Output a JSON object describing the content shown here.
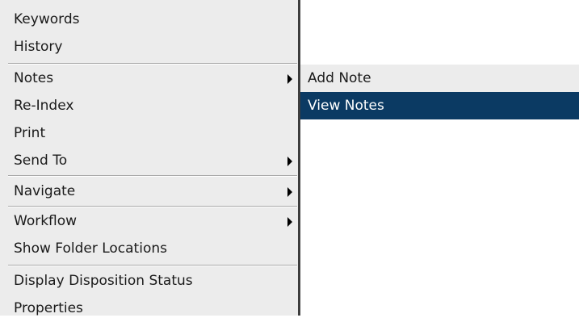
{
  "context_menu": {
    "items": [
      {
        "label": "Keywords"
      },
      {
        "label": "History"
      },
      {
        "label": "Notes"
      },
      {
        "label": "Re-Index"
      },
      {
        "label": "Print"
      },
      {
        "label": "Send To"
      },
      {
        "label": "Navigate"
      },
      {
        "label": "Workflow"
      },
      {
        "label": "Show Folder Locations"
      },
      {
        "label": "Display Disposition Status"
      },
      {
        "label": "Properties"
      }
    ]
  },
  "notes_submenu": {
    "items": [
      {
        "label": "Add Note"
      },
      {
        "label": "View Notes"
      }
    ]
  },
  "colors": {
    "menu_background": "#ececec",
    "highlight": "#0b3a63",
    "menu_border": "#3d3d3d"
  }
}
